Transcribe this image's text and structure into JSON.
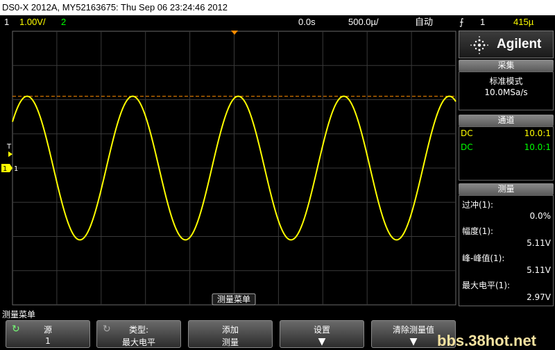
{
  "title_bar": "DS0-X 2012A, MY52163675: Thu Sep 06 23:24:46 2012",
  "status": {
    "ch1_label": "1",
    "ch1_scale": "1.00V/",
    "ch2_label": "2",
    "time_offset": "0.0s",
    "time_scale": "500.0µ/",
    "trigger_mode": "自动",
    "trigger_icon": "rising-edge-icon",
    "trigger_source": "1",
    "trigger_level": "415µ"
  },
  "colors": {
    "ch1": "#ffff00",
    "ch2": "#00ff00",
    "trigger_marker": "#ff8c00"
  },
  "waveform": {
    "cycles": 4.2,
    "amplitude_ratio": 0.5
  },
  "ch1_marker": "1",
  "trigger_marker_label": "T",
  "measure_menu_tag": "测量菜单",
  "brand": "Agilent",
  "acquire": {
    "title": "采集",
    "mode": "标准模式",
    "rate": "10.0MSa/s"
  },
  "channels": {
    "title": "通道",
    "rows": [
      {
        "coupling": "DC",
        "probe": "10.0:1"
      },
      {
        "coupling": "DC",
        "probe": "10.0:1"
      }
    ]
  },
  "measurements": {
    "title": "测量",
    "items": [
      {
        "name": "过冲(1):",
        "value": "0.0%"
      },
      {
        "name": "幅度(1):",
        "value": "5.11V"
      },
      {
        "name": "峰-峰值(1):",
        "value": "5.11V"
      },
      {
        "name": "最大电平(1):",
        "value": "2.97V"
      }
    ]
  },
  "menu_label": "测量菜单",
  "softkeys": [
    {
      "top": "源",
      "bottom": "1"
    },
    {
      "top": "类型:",
      "bottom": "最大电平"
    },
    {
      "top": "添加",
      "bottom": "测量"
    },
    {
      "top": "设置",
      "bottom": ""
    },
    {
      "top": "清除测量值",
      "bottom": ""
    }
  ],
  "watermark": "bbs.38hot.net"
}
